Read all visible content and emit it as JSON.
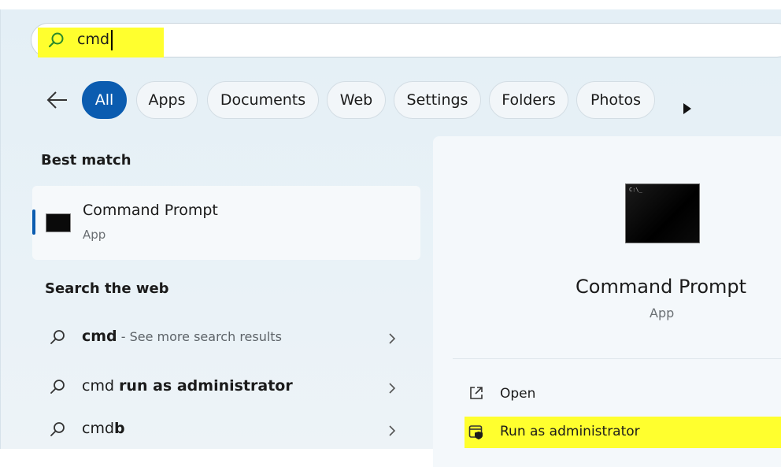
{
  "search": {
    "query": "cmd"
  },
  "filters": {
    "items": [
      "All",
      "Apps",
      "Documents",
      "Web",
      "Settings",
      "Folders",
      "Photos"
    ],
    "active": "All"
  },
  "best_match": {
    "heading": "Best match",
    "title": "Command Prompt",
    "subtitle": "App"
  },
  "web": {
    "heading": "Search the web",
    "rows": [
      {
        "bold": "cmd",
        "normal": "",
        "muted": " - See more search results"
      },
      {
        "bold": "run as administrator",
        "normal": "cmd ",
        "muted": ""
      },
      {
        "bold": "b",
        "normal": "cmd",
        "muted": ""
      }
    ]
  },
  "preview": {
    "title": "Command Prompt",
    "subtitle": "App",
    "actions": [
      {
        "label": "Open",
        "icon": "open-external-icon"
      },
      {
        "label": "Run as administrator",
        "icon": "admin-shield-icon"
      }
    ]
  },
  "colors": {
    "accent": "#0b5cb0",
    "highlight": "#ffff2e",
    "search_icon": "#2a8a2a"
  }
}
